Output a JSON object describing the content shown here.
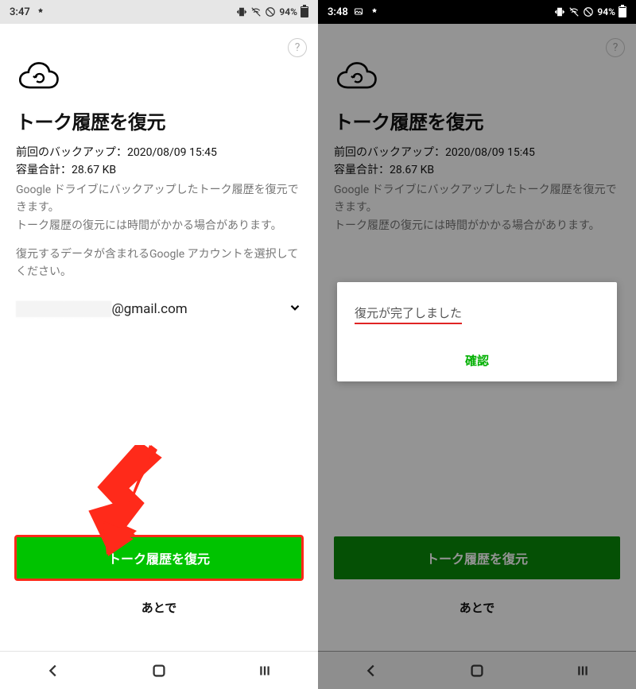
{
  "left": {
    "status": {
      "time": "3:47",
      "battery_pct": "94%"
    },
    "help": "?",
    "title": "トーク履歴を復元",
    "last_backup_label": "前回のバックアップ：",
    "last_backup_value": "2020/08/09 15:45",
    "size_label": "容量合計：",
    "size_value": "28.67 KB",
    "desc1": "Google ドライブにバックアップしたトーク履歴を復元できます。\nトーク履歴の復元には時間がかかる場合があります。",
    "desc2": "復元するデータが含まれるGoogle アカウントを選択してください。",
    "account_hidden": "██████████",
    "account_suffix": "@gmail.com",
    "primary_label": "トーク履歴を復元",
    "later_label": "あとで"
  },
  "right": {
    "status": {
      "time": "3:48",
      "battery_pct": "94%"
    },
    "help": "?",
    "title": "トーク履歴を復元",
    "last_backup_label": "前回のバックアップ：",
    "last_backup_value": "2020/08/09 15:45",
    "size_label": "容量合計：",
    "size_value": "28.67 KB",
    "desc1": "Google ドライブにバックアップしたトーク履歴を復元できます。\nトーク履歴の復元には時間がかかる場合があります。",
    "primary_label": "トーク履歴を復元",
    "later_label": "あとで",
    "dialog": {
      "message": "復元が完了しました",
      "confirm": "確認"
    }
  }
}
